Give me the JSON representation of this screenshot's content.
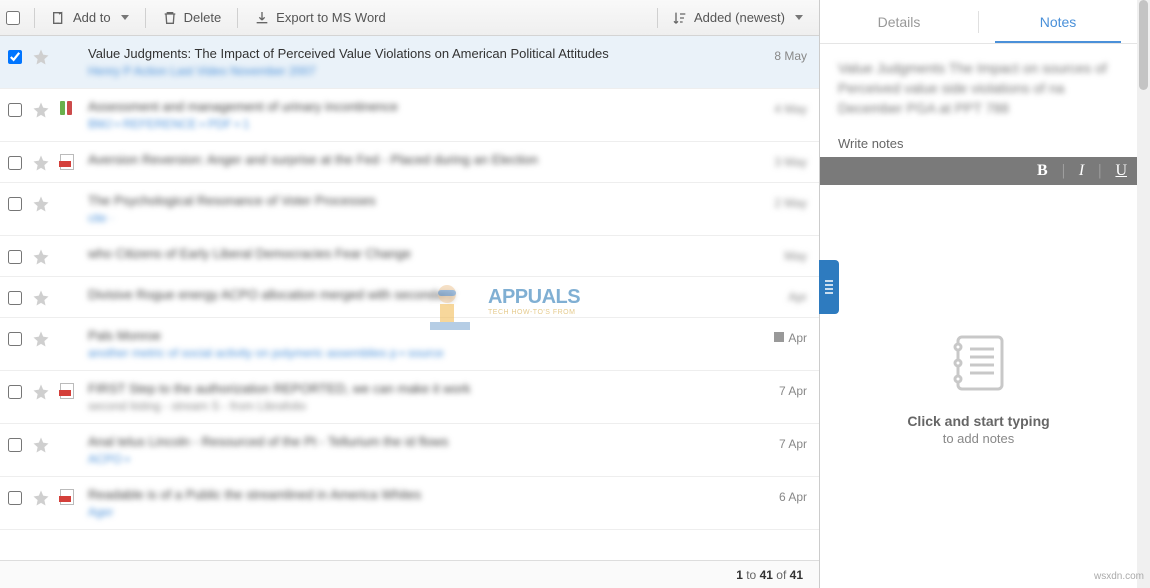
{
  "toolbar": {
    "add_to": "Add to",
    "delete": "Delete",
    "export": "Export to MS Word",
    "sort": "Added (newest)"
  },
  "selected_item": {
    "title": "Value Judgments: The Impact of Perceived Value Violations on American Political Attitudes",
    "meta": "Henry P Action Last Video November 2007",
    "date": "8 May"
  },
  "rows": [
    {
      "id": 1,
      "selected": true,
      "has_pdf": false,
      "date": "8 May",
      "date_blur": false
    },
    {
      "id": 2,
      "has_pdf": true,
      "dots": true,
      "date": "",
      "date_blur": true
    },
    {
      "id": 3,
      "has_pdf": true,
      "date": "",
      "date_blur": true
    },
    {
      "id": 4,
      "has_pdf": false,
      "date": "",
      "date_blur": true
    },
    {
      "id": 5,
      "has_pdf": false,
      "date": "",
      "date_blur": true
    },
    {
      "id": 6,
      "has_pdf": false,
      "date": "",
      "date_blur": true,
      "gray": true
    },
    {
      "id": 7,
      "has_pdf": false,
      "date": "Apr",
      "date_blur": true,
      "square": true
    },
    {
      "id": 8,
      "has_pdf": true,
      "date": "7 Apr",
      "date_blur": false,
      "gray": true
    },
    {
      "id": 9,
      "has_pdf": false,
      "date": "7 Apr",
      "date_blur": false
    },
    {
      "id": 10,
      "has_pdf": true,
      "date": "6 Apr",
      "date_blur": false
    }
  ],
  "pager": {
    "from": "1",
    "to": "41",
    "total": "41",
    "sep": "to",
    "of": "of"
  },
  "tabs": {
    "details": "Details",
    "notes": "Notes"
  },
  "notes": {
    "label": "Write notes",
    "cta_strong": "Click and start typing",
    "cta_sub": "to add notes"
  },
  "watermark": {
    "brand": "APPUALS",
    "tag": "TECH HOW-TO'S FROM"
  },
  "source": "wsxdn.com"
}
